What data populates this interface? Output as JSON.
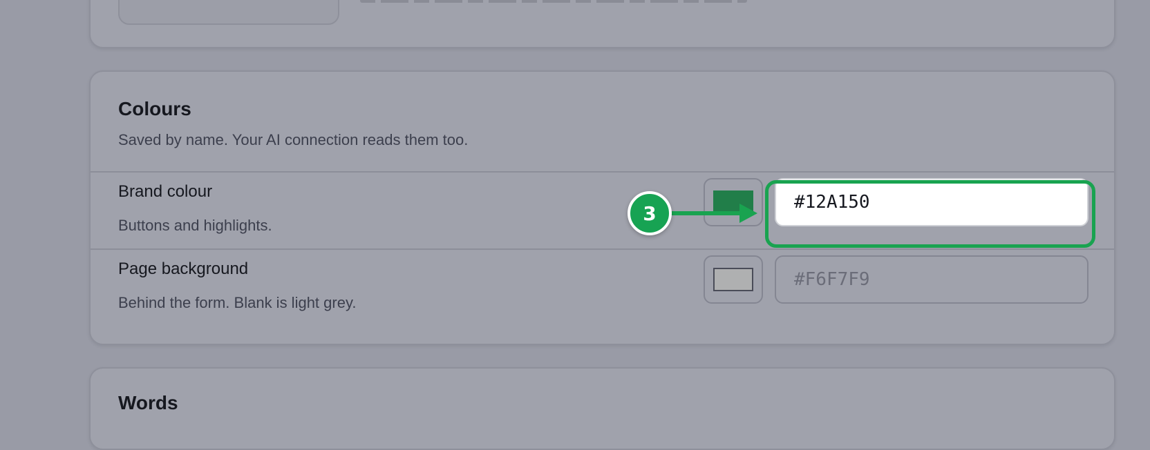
{
  "colours_section": {
    "title": "Colours",
    "description": "Saved by name. Your AI connection reads them too.",
    "rows": [
      {
        "label": "Brand colour",
        "help": "Buttons and highlights.",
        "swatch_color": "#12A150",
        "value": "#12A150",
        "placeholder": ""
      },
      {
        "label": "Page background",
        "help": "Behind the form. Blank is light grey.",
        "swatch_color": "#F6F7F9",
        "value": "",
        "placeholder": "#F6F7F9"
      }
    ]
  },
  "words_section": {
    "title": "Words"
  },
  "annotation": {
    "step_number": "3",
    "accent_color": "#19A350"
  }
}
